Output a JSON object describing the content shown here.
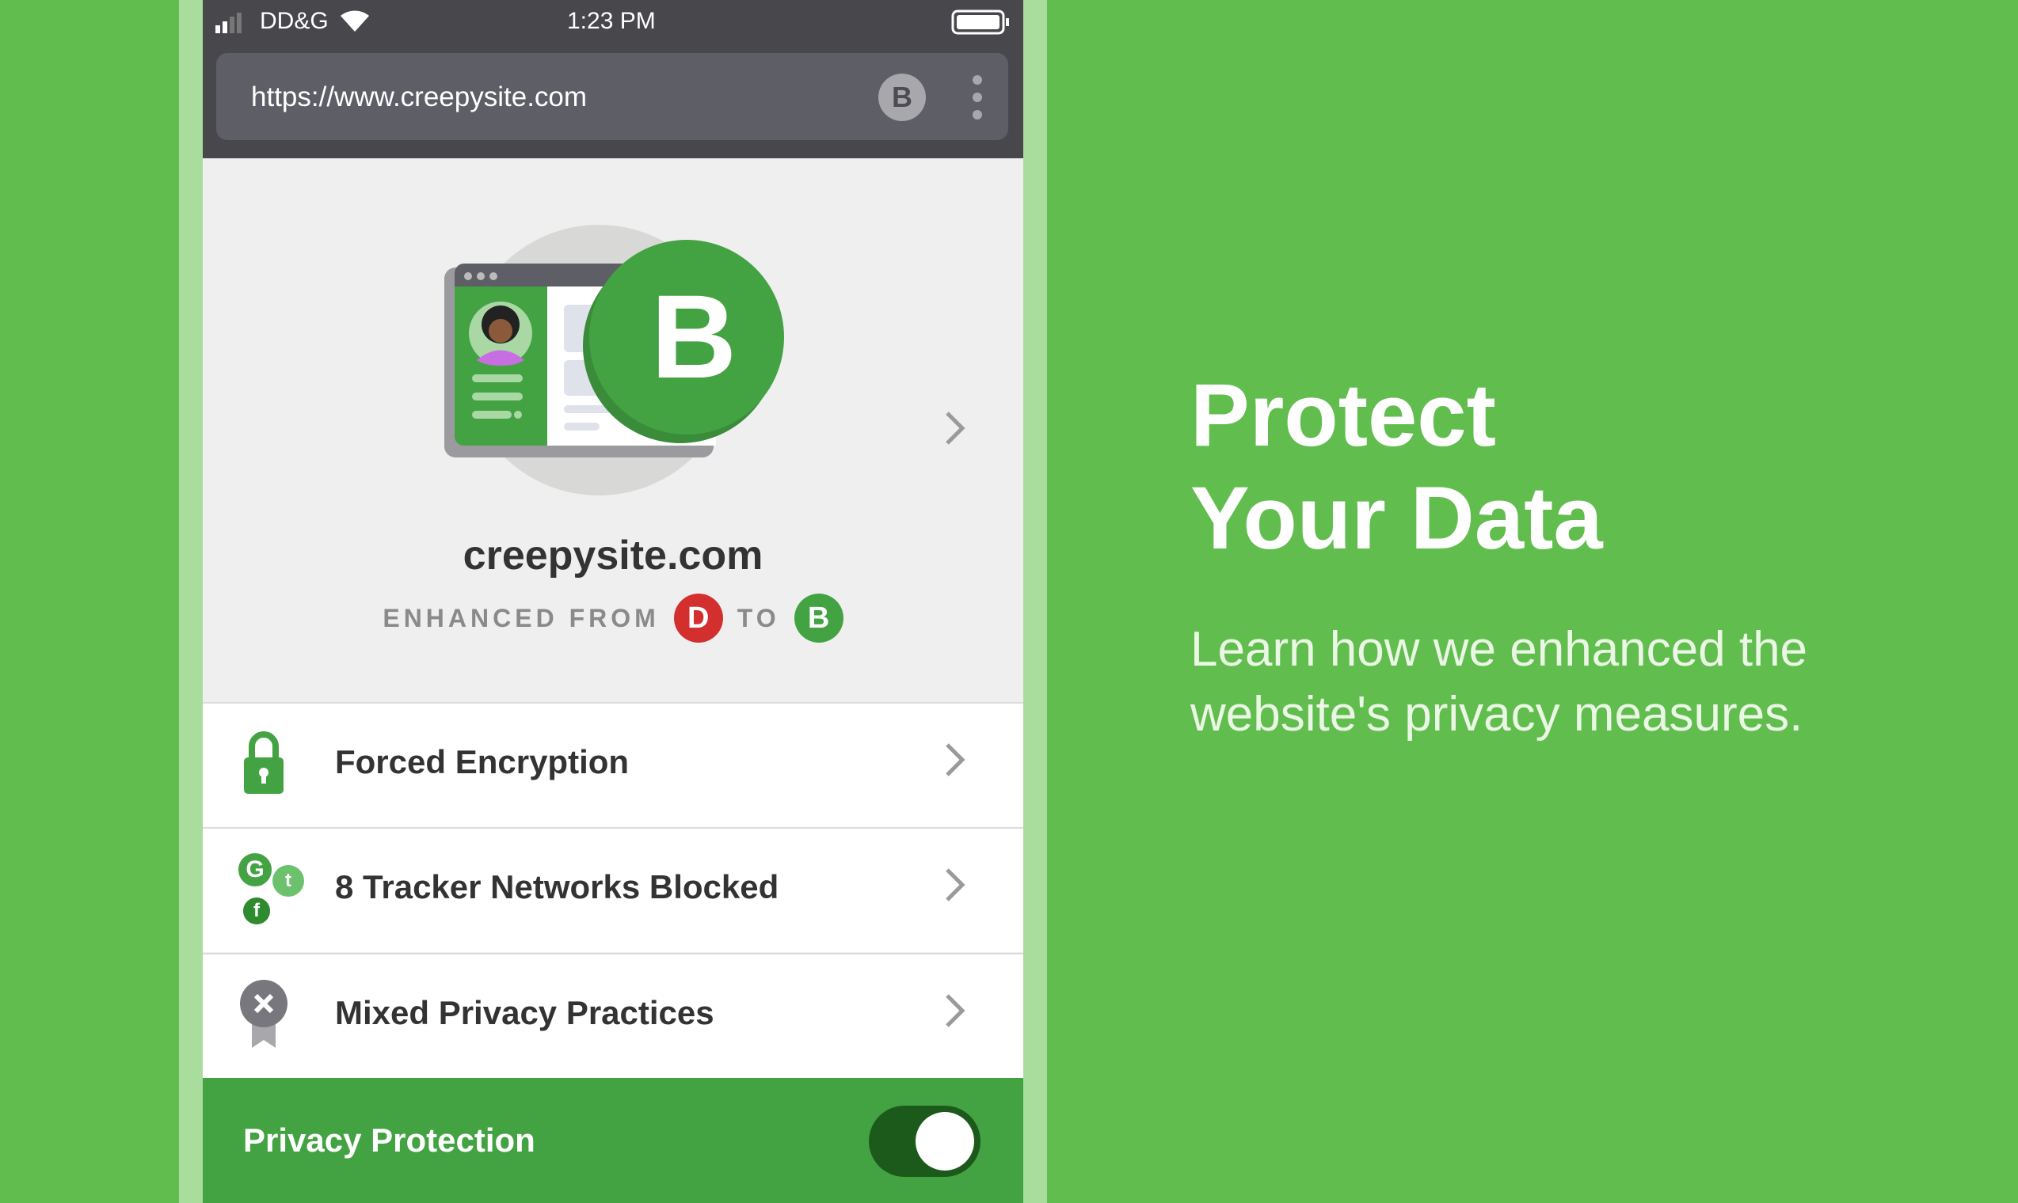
{
  "colors": {
    "background": "#62bd4f",
    "accent_green": "#43a343",
    "grade_bad": "#d32f2f",
    "toggle_on": "#1c5a1c"
  },
  "status_bar": {
    "carrier": "DD&G",
    "time": "1:23 PM",
    "icons": [
      "signal-icon",
      "wifi-icon",
      "battery-icon"
    ]
  },
  "browser": {
    "url": "https://www.creepysite.com",
    "grade_badge": "B",
    "menu_icon": "more-vertical-icon"
  },
  "summary": {
    "grade_illustration": "B",
    "site_name": "creepysite.com",
    "enhanced_from_label": "ENHANCED FROM",
    "from_grade": "D",
    "to_label": "TO",
    "to_grade": "B"
  },
  "rows": [
    {
      "label": "Forced Encryption",
      "icon": "lock-icon"
    },
    {
      "label": "8 Tracker Networks Blocked",
      "icon": "tracker-networks-icon",
      "tracker_letters": [
        "G",
        "t",
        "f"
      ]
    },
    {
      "label": "Mixed Privacy Practices",
      "icon": "privacy-badge-x-icon"
    }
  ],
  "footer": {
    "label": "Privacy Protection",
    "toggle_on": true
  },
  "promo": {
    "title_line1": "Protect",
    "title_line2": "Your Data",
    "subtitle_line1": "Learn how we enhanced the",
    "subtitle_line2": "website's privacy measures."
  }
}
